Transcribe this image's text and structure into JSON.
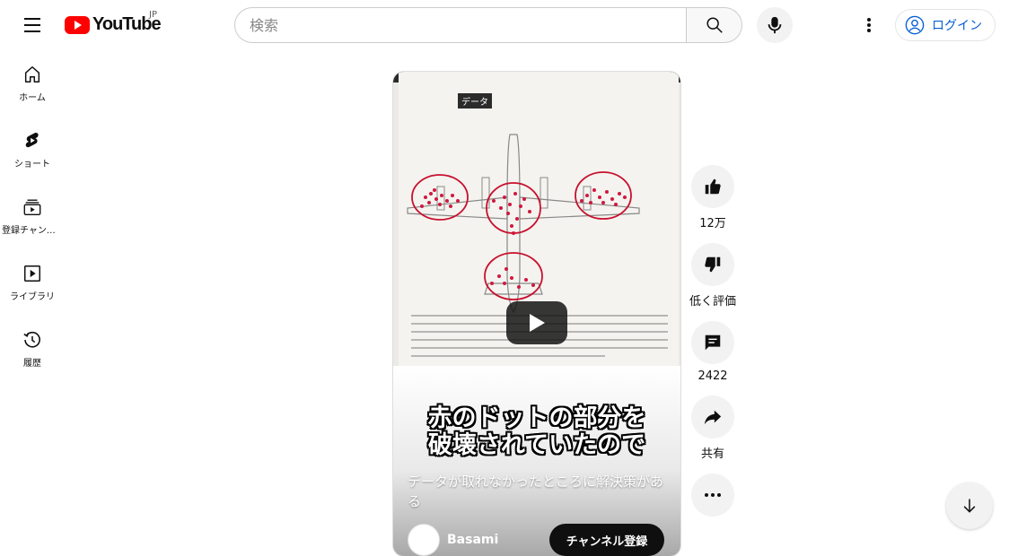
{
  "header": {
    "logo_text": "YouTube",
    "region": "JP",
    "search_placeholder": "検索",
    "login_label": "ログイン"
  },
  "sidebar": {
    "items": [
      {
        "label": "ホーム",
        "icon": "home-icon"
      },
      {
        "label": "ショート",
        "icon": "shorts-icon"
      },
      {
        "label": "登録チャンネル",
        "icon": "subscriptions-icon"
      },
      {
        "label": "ライブラリ",
        "icon": "library-icon"
      },
      {
        "label": "履歴",
        "icon": "history-icon"
      }
    ]
  },
  "short": {
    "image_tag": "データ",
    "overlay_caption_line1": "赤のドットの部分を",
    "overlay_caption_line2": "破壊されていたので",
    "title": "データが取れなかったところに解決策がある",
    "channel_name": "Basami",
    "subscribe_label": "チャンネル登録"
  },
  "actions": {
    "like_count": "12万",
    "dislike_label": "低く評価",
    "comment_count": "2422",
    "share_label": "共有"
  },
  "colors": {
    "brand_red": "#ff0000",
    "link_blue": "#065fd4",
    "button_gray": "#f2f2f2"
  }
}
